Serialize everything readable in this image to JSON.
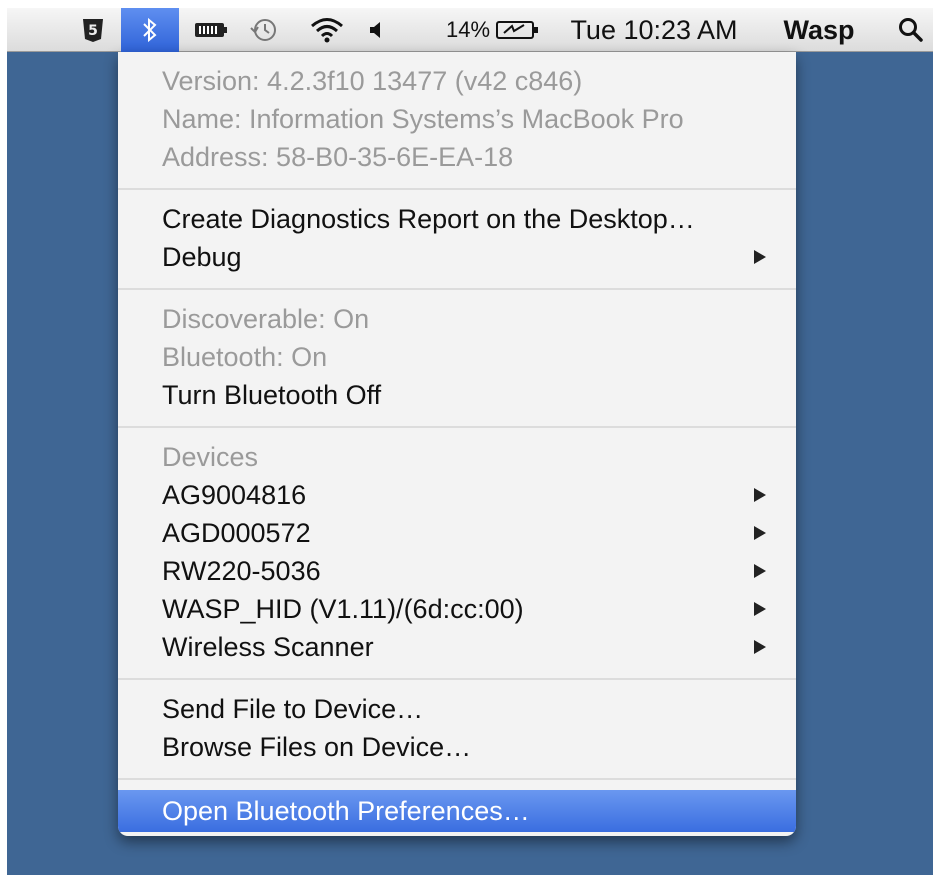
{
  "menubar": {
    "icons": [
      {
        "name": "html5-icon"
      },
      {
        "name": "bluetooth-icon"
      },
      {
        "name": "battery-icon"
      },
      {
        "name": "time-machine-icon"
      },
      {
        "name": "wifi-icon"
      },
      {
        "name": "volume-icon"
      }
    ],
    "battery_percent": "14%",
    "clock": "Tue 10:23 AM",
    "user": "Wasp",
    "search_icon": "spotlight-icon",
    "accent_color": "#3a6ee0"
  },
  "menu": {
    "info": {
      "version": "Version: 4.2.3f10 13477 (v42 c846)",
      "name": "Name: Information Systems’s MacBook Pro",
      "address": "Address: 58-B0-35-6E-EA-18"
    },
    "diagnostics": {
      "create_report": "Create Diagnostics Report on the Desktop…",
      "debug": "Debug"
    },
    "status": {
      "discoverable": "Discoverable: On",
      "bluetooth": "Bluetooth: On",
      "turn_off": "Turn Bluetooth Off"
    },
    "devices": {
      "header": "Devices",
      "items": [
        {
          "label": "AG9004816"
        },
        {
          "label": "AGD000572"
        },
        {
          "label": "RW220-5036"
        },
        {
          "label": "WASP_HID (V1.11)/(6d:cc:00)"
        },
        {
          "label": "Wireless Scanner"
        }
      ]
    },
    "files": {
      "send": "Send File to Device…",
      "browse": "Browse Files on Device…"
    },
    "preferences": "Open Bluetooth Preferences…"
  }
}
